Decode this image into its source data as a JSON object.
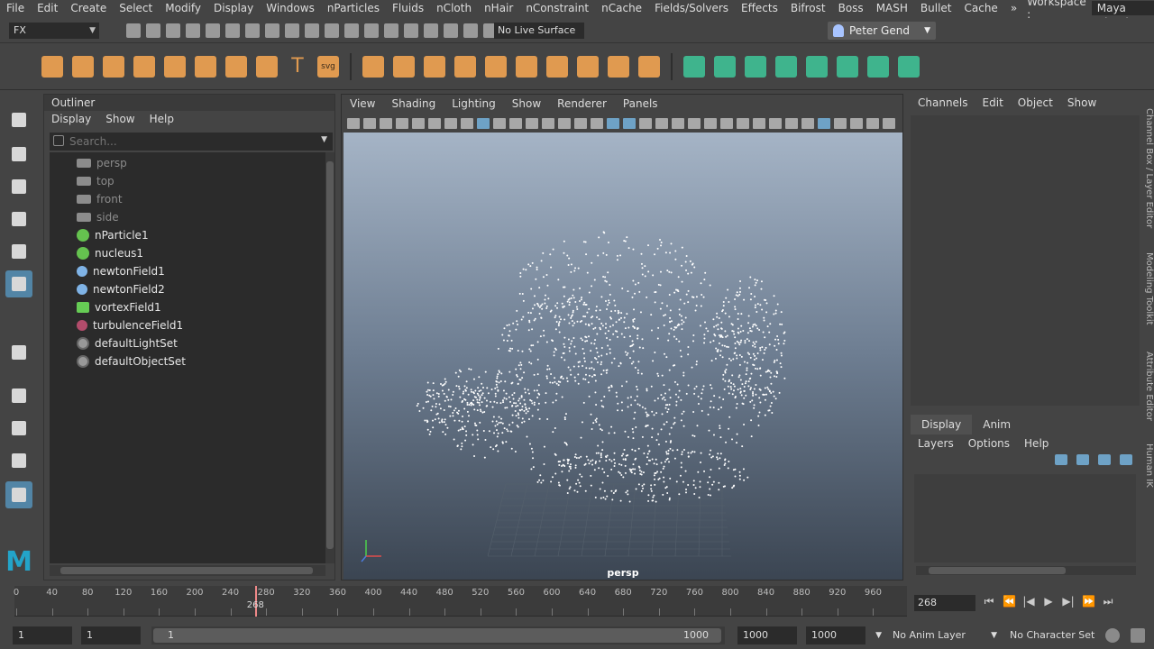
{
  "menubar": {
    "items": [
      "File",
      "Edit",
      "Create",
      "Select",
      "Modify",
      "Display",
      "Windows",
      "nParticles",
      "Fluids",
      "nCloth",
      "nHair",
      "nConstraint",
      "nCache",
      "Fields/Solvers",
      "Effects",
      "Bifrost",
      "Boss",
      "MASH",
      "Bullet",
      "Cache"
    ],
    "overflow": "»",
    "workspace_label": "Workspace :",
    "workspace_value": "Maya Classic"
  },
  "statusline": {
    "mode": "FX",
    "live_surface": "No Live Surface",
    "user": "Peter Gend"
  },
  "shelf": {
    "orange_icons": 20,
    "green_icons": 8,
    "text_icons": {
      "text": "T",
      "svg": "svg"
    }
  },
  "outliner": {
    "title": "Outliner",
    "menus": [
      "Display",
      "Show",
      "Help"
    ],
    "search_placeholder": "Search...",
    "items": [
      {
        "label": "persp",
        "type": "cam"
      },
      {
        "label": "top",
        "type": "cam"
      },
      {
        "label": "front",
        "type": "cam"
      },
      {
        "label": "side",
        "type": "cam"
      },
      {
        "label": "nParticle1",
        "type": "nparticle"
      },
      {
        "label": "nucleus1",
        "type": "nparticle"
      },
      {
        "label": "newtonField1",
        "type": "field"
      },
      {
        "label": "newtonField2",
        "type": "field"
      },
      {
        "label": "vortexField1",
        "type": "vortex"
      },
      {
        "label": "turbulenceField1",
        "type": "turb"
      },
      {
        "label": "defaultLightSet",
        "type": "set"
      },
      {
        "label": "defaultObjectSet",
        "type": "set"
      }
    ]
  },
  "viewport": {
    "menus": [
      "View",
      "Shading",
      "Lighting",
      "Show",
      "Renderer",
      "Panels"
    ],
    "camera_label": "persp"
  },
  "channelbox": {
    "menus": [
      "Channels",
      "Edit",
      "Object",
      "Show"
    ]
  },
  "layereditor": {
    "tabs": [
      "Display",
      "Anim"
    ],
    "menus": [
      "Layers",
      "Options",
      "Help"
    ]
  },
  "sidetabs": [
    "Channel Box / Layer Editor",
    "Modeling Toolkit",
    "Attribute Editor",
    "Human IK"
  ],
  "timeslider": {
    "ticks": [
      0,
      40,
      80,
      120,
      160,
      200,
      240,
      280,
      320,
      360,
      400,
      440,
      480,
      520,
      560,
      600,
      640,
      680,
      720,
      760,
      800,
      840,
      880,
      920,
      960
    ],
    "range_max": 1000,
    "current_frame": "268",
    "current_frame_field": "268",
    "playback_glyphs": [
      "⏮",
      "⏪",
      "|◀",
      "▶",
      "▶|",
      "⏩",
      "⏭"
    ]
  },
  "rangeslider": {
    "start": "1",
    "playback_start": "1",
    "bar_start": "1",
    "bar_end": "1000",
    "playback_end": "1000",
    "end": "1000",
    "anim_layer": "No Anim Layer",
    "character_set": "No Character Set"
  },
  "colors": {
    "accent": "#5285a6",
    "shelf_orange": "#e09a50",
    "shelf_green": "#3fb48d",
    "maya_logo": "#23a4c9"
  }
}
